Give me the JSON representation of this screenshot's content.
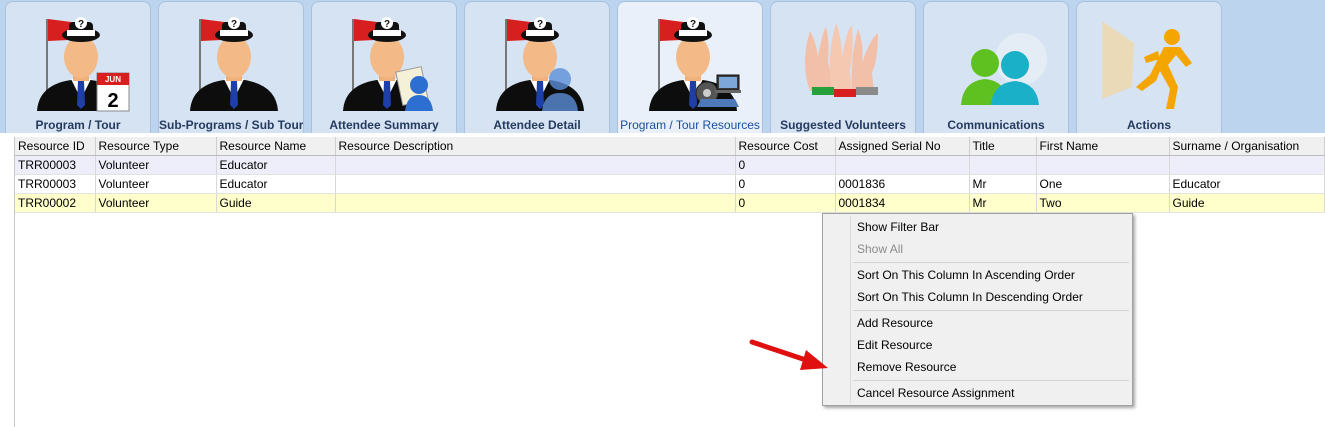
{
  "tabs": [
    {
      "label": "Program / Tour",
      "icon": "program-calendar-icon"
    },
    {
      "label": "Sub-Programs / Sub Tours",
      "icon": "sub-program-person-icon"
    },
    {
      "label": "Attendee Summary",
      "icon": "attendee-summary-icon"
    },
    {
      "label": "Attendee Detail",
      "icon": "attendee-detail-icon"
    },
    {
      "label": "Program / Tour Resources",
      "icon": "resources-icon",
      "active": true
    },
    {
      "label": "Suggested Volunteers",
      "icon": "raised-hands-icon"
    },
    {
      "label": "Communications",
      "icon": "communications-people-icon"
    },
    {
      "label": "Actions",
      "icon": "running-man-icon"
    }
  ],
  "calendar_icon": {
    "month": "JUN",
    "day": "2"
  },
  "grid": {
    "columns": [
      "Resource ID",
      "Resource Type",
      "Resource Name",
      "Resource Description",
      "Resource Cost",
      "Assigned Serial No",
      "Title",
      "First Name",
      "Surname / Organisation"
    ],
    "rows": [
      [
        "TRR00003",
        "Volunteer",
        "Educator",
        "",
        "0",
        "",
        "",
        "",
        ""
      ],
      [
        "TRR00003",
        "Volunteer",
        "Educator",
        "",
        "0",
        "0001836",
        "Mr",
        "One",
        "Educator"
      ],
      [
        "TRR00002",
        "Volunteer",
        "Guide",
        "",
        "0",
        "0001834",
        "Mr",
        "Two",
        "Guide"
      ]
    ]
  },
  "context_menu": {
    "items": [
      {
        "label": "Show Filter Bar",
        "enabled": true
      },
      {
        "label": "Show All",
        "enabled": false
      },
      {
        "label": "Sort On This Column In Ascending Order",
        "enabled": true
      },
      {
        "label": "Sort On This Column In Descending Order",
        "enabled": true
      },
      {
        "label": "Add Resource",
        "enabled": true
      },
      {
        "label": "Edit Resource",
        "enabled": true
      },
      {
        "label": "Remove Resource",
        "enabled": true
      },
      {
        "label": "Cancel Resource Assignment",
        "enabled": true
      }
    ]
  },
  "colors": {
    "tab_bar": "#bcd4ee",
    "highlight_row": "#ffffcc",
    "empty_row": "#eeeefb",
    "arrow": "#e01010"
  }
}
